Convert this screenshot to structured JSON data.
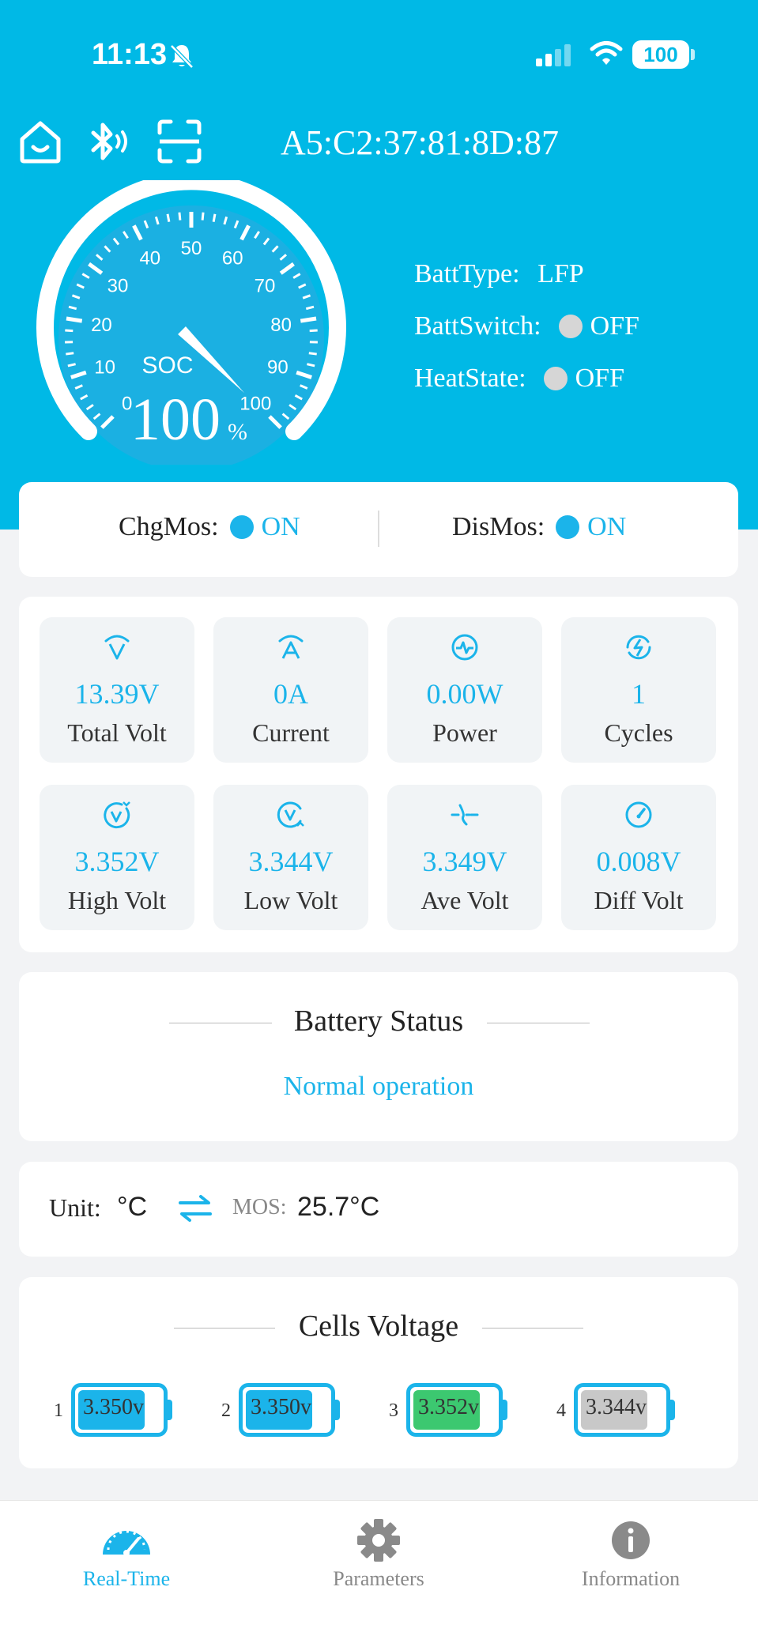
{
  "status_bar": {
    "time": "11:13",
    "battery_level": "100"
  },
  "device": {
    "mac": "A5:C2:37:81:8D:87"
  },
  "gauge": {
    "label": "SOC",
    "value": "100",
    "unit": "%",
    "value_percent": 100,
    "ticks": [
      "0",
      "10",
      "20",
      "30",
      "40",
      "50",
      "60",
      "70",
      "80",
      "90",
      "100"
    ]
  },
  "batt_info": {
    "type_label": "BattType:",
    "type_value": "LFP",
    "switch_label": "BattSwitch:",
    "switch_value": "OFF",
    "heat_label": "HeatState:",
    "heat_value": "OFF"
  },
  "mos": {
    "chg_label": "ChgMos:",
    "chg_value": "ON",
    "dis_label": "DisMos:",
    "dis_value": "ON"
  },
  "stats": [
    {
      "value": "13.39V",
      "label": "Total Volt",
      "icon": "total-volt-icon"
    },
    {
      "value": "0A",
      "label": "Current",
      "icon": "current-icon"
    },
    {
      "value": "0.00W",
      "label": "Power",
      "icon": "power-icon"
    },
    {
      "value": "1",
      "label": "Cycles",
      "icon": "cycles-icon"
    },
    {
      "value": "3.352V",
      "label": "High Volt",
      "icon": "high-volt-icon"
    },
    {
      "value": "3.344V",
      "label": "Low Volt",
      "icon": "low-volt-icon"
    },
    {
      "value": "3.349V",
      "label": "Ave Volt",
      "icon": "ave-volt-icon"
    },
    {
      "value": "0.008V",
      "label": "Diff Volt",
      "icon": "diff-volt-icon"
    }
  ],
  "battery_status": {
    "title": "Battery Status",
    "text": "Normal operation"
  },
  "temperature": {
    "unit_label": "Unit:",
    "unit_value": "°C",
    "mos_label": "MOS:",
    "mos_value": "25.7°C"
  },
  "cells": {
    "title": "Cells Voltage",
    "items": [
      {
        "index": "1",
        "voltage": "3.350v",
        "color": "#1bb4ea"
      },
      {
        "index": "2",
        "voltage": "3.350v",
        "color": "#1bb4ea"
      },
      {
        "index": "3",
        "voltage": "3.352v",
        "color": "#3cc870"
      },
      {
        "index": "4",
        "voltage": "3.344v",
        "color": "#c8c8c8"
      }
    ]
  },
  "nav": [
    {
      "label": "Real-Time",
      "icon": "speedometer-icon",
      "active": true
    },
    {
      "label": "Parameters",
      "icon": "gear-icon",
      "active": false
    },
    {
      "label": "Information",
      "icon": "info-icon",
      "active": false
    }
  ],
  "colors": {
    "primary": "#00b9e6",
    "accent": "#1bb4ea",
    "page_bg": "#f2f3f5"
  }
}
